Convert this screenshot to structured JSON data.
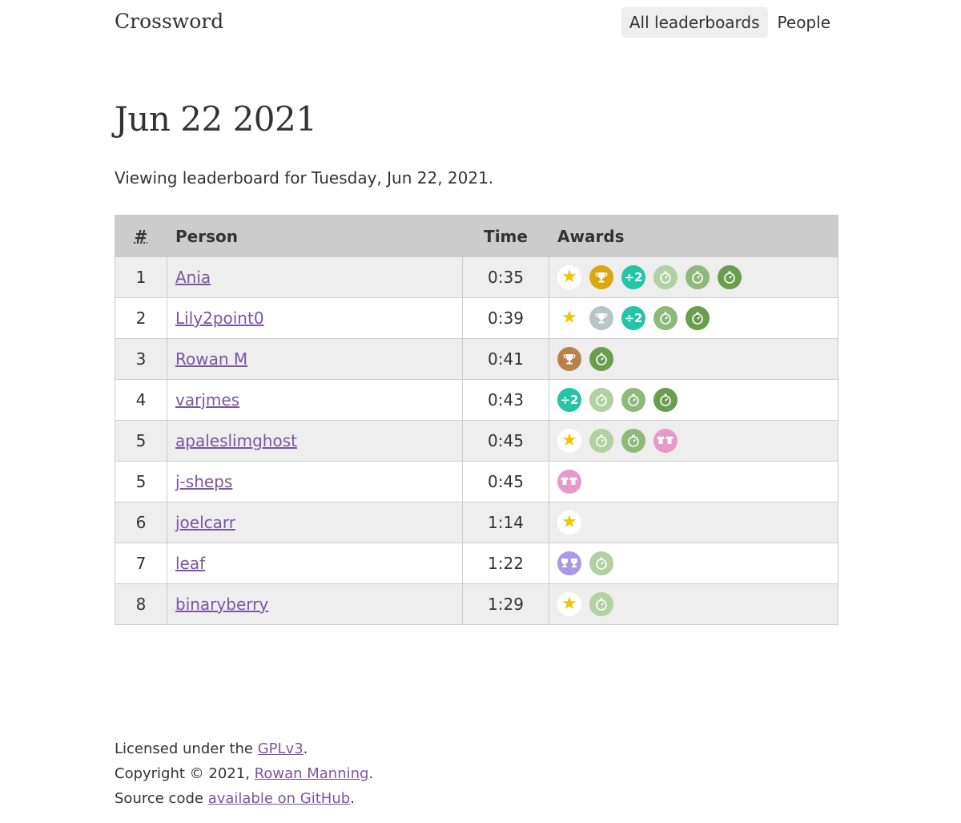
{
  "header": {
    "brand": "Crossword",
    "nav": [
      "All leaderboards",
      "People"
    ]
  },
  "page": {
    "title": "Jun 22 2021",
    "intro": "Viewing leaderboard for Tuesday, Jun 22, 2021."
  },
  "table": {
    "headers": {
      "rank": "#",
      "person": "Person",
      "time": "Time",
      "awards": "Awards"
    },
    "rows": [
      {
        "rank": "1",
        "person": "Ania",
        "time": "0:35",
        "awards": [
          "star-icon",
          "gold-trophy-icon",
          "half-time-icon",
          "stopwatch-light-icon",
          "stopwatch-medium-icon",
          "stopwatch-dark-icon"
        ]
      },
      {
        "rank": "2",
        "person": "Lily2point0",
        "time": "0:39",
        "awards": [
          "star-icon",
          "silver-trophy-icon",
          "half-time-icon",
          "stopwatch-medium-icon",
          "stopwatch-dark-icon"
        ]
      },
      {
        "rank": "3",
        "person": "Rowan M",
        "time": "0:41",
        "awards": [
          "bronze-trophy-icon",
          "stopwatch-dark-icon"
        ]
      },
      {
        "rank": "4",
        "person": "varjmes",
        "time": "0:43",
        "awards": [
          "half-time-icon",
          "stopwatch-light-icon",
          "stopwatch-medium-icon",
          "stopwatch-dark-icon"
        ]
      },
      {
        "rank": "5",
        "person": "apaleslimghost",
        "time": "0:45",
        "awards": [
          "star-icon",
          "stopwatch-light-icon",
          "stopwatch-medium-icon",
          "twin-shirts-icon"
        ]
      },
      {
        "rank": "5",
        "person": "j-sheps",
        "time": "0:45",
        "awards": [
          "twin-shirts-icon"
        ]
      },
      {
        "rank": "6",
        "person": "joelcarr",
        "time": "1:14",
        "awards": [
          "star-icon"
        ]
      },
      {
        "rank": "7",
        "person": "leaf",
        "time": "1:22",
        "awards": [
          "twin-trophies-icon",
          "stopwatch-light-icon"
        ]
      },
      {
        "rank": "8",
        "person": "binaryberry",
        "time": "1:29",
        "awards": [
          "star-icon",
          "stopwatch-light-icon"
        ]
      }
    ]
  },
  "footer": {
    "license_prefix": "Licensed under the ",
    "license_link": "GPLv3",
    "license_suffix": ".",
    "copyright_prefix": "Copyright © 2021, ",
    "copyright_link": "Rowan Manning",
    "copyright_suffix": ".",
    "source_prefix": "Source code ",
    "source_link": "available on GitHub",
    "source_suffix": "."
  },
  "colors": {
    "link": "#7a55a3",
    "header_bg": "#cccccc",
    "row_alt_bg": "#eeeeee",
    "gold": "#d7a811",
    "silver": "#b6c6c5",
    "bronze": "#b9814b",
    "half": "#22c5a6",
    "stopwatch_light": "#b2d0a0",
    "stopwatch_medium": "#8db97b",
    "stopwatch_dark": "#6a9e4f",
    "pink": "#e79ac8",
    "purple": "#a99ae8",
    "star": "#f3c400"
  }
}
